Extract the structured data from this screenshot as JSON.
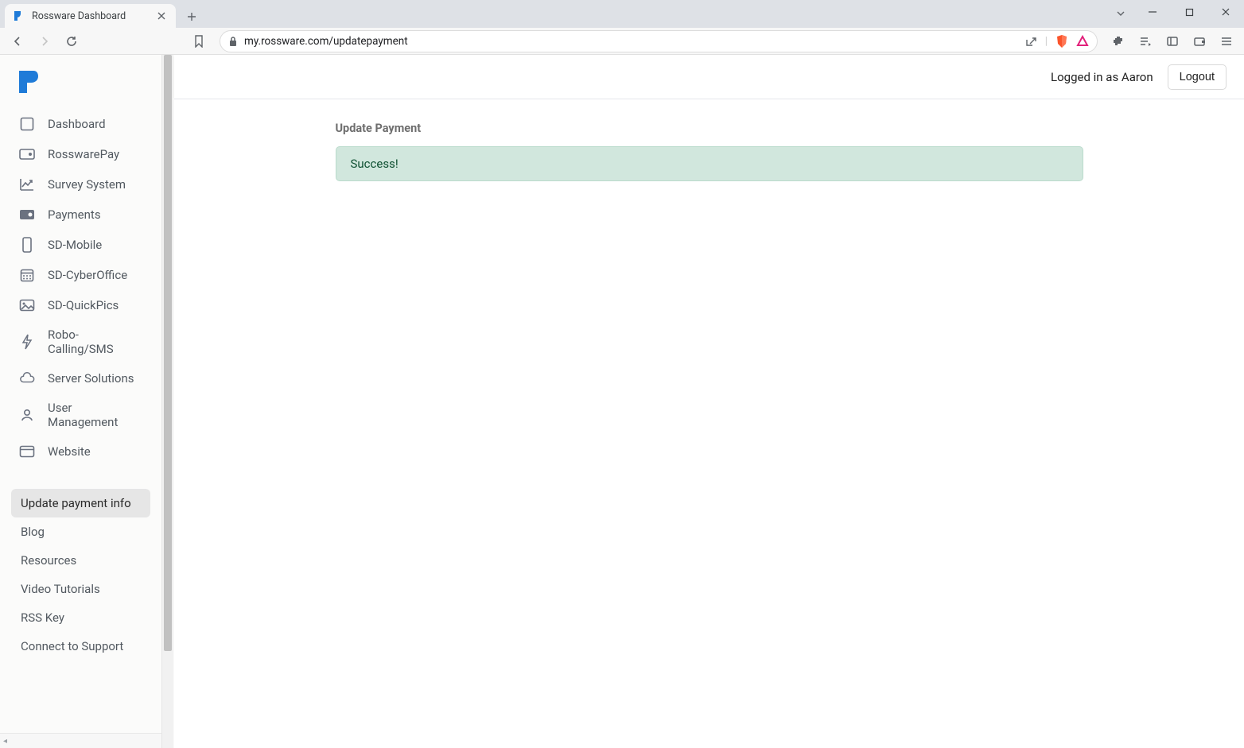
{
  "browser": {
    "tab_title": "Rossware Dashboard",
    "url": "my.rossware.com/updatepayment"
  },
  "sidebar": {
    "nav": [
      {
        "label": "Dashboard",
        "icon": "dashboard-icon"
      },
      {
        "label": "RosswarePay",
        "icon": "rosswarepay-icon"
      },
      {
        "label": "Survey System",
        "icon": "chart-line-icon"
      },
      {
        "label": "Payments",
        "icon": "payments-icon"
      },
      {
        "label": "SD-Mobile",
        "icon": "mobile-icon"
      },
      {
        "label": "SD-CyberOffice",
        "icon": "calendar-icon"
      },
      {
        "label": "SD-QuickPics",
        "icon": "image-icon"
      },
      {
        "label": "Robo-Calling/SMS",
        "icon": "bolt-icon"
      },
      {
        "label": "Server Solutions",
        "icon": "cloud-icon"
      },
      {
        "label": "User Management",
        "icon": "user-icon"
      },
      {
        "label": "Website",
        "icon": "window-icon"
      }
    ],
    "secondary": [
      {
        "label": "Update payment info",
        "active": true
      },
      {
        "label": "Blog"
      },
      {
        "label": "Resources"
      },
      {
        "label": "Video Tutorials"
      },
      {
        "label": "RSS Key"
      },
      {
        "label": "Connect to Support"
      }
    ]
  },
  "header": {
    "logged_in_text": "Logged in as Aaron",
    "logout_label": "Logout"
  },
  "main": {
    "heading": "Update Payment",
    "alert_text": "Success!"
  }
}
